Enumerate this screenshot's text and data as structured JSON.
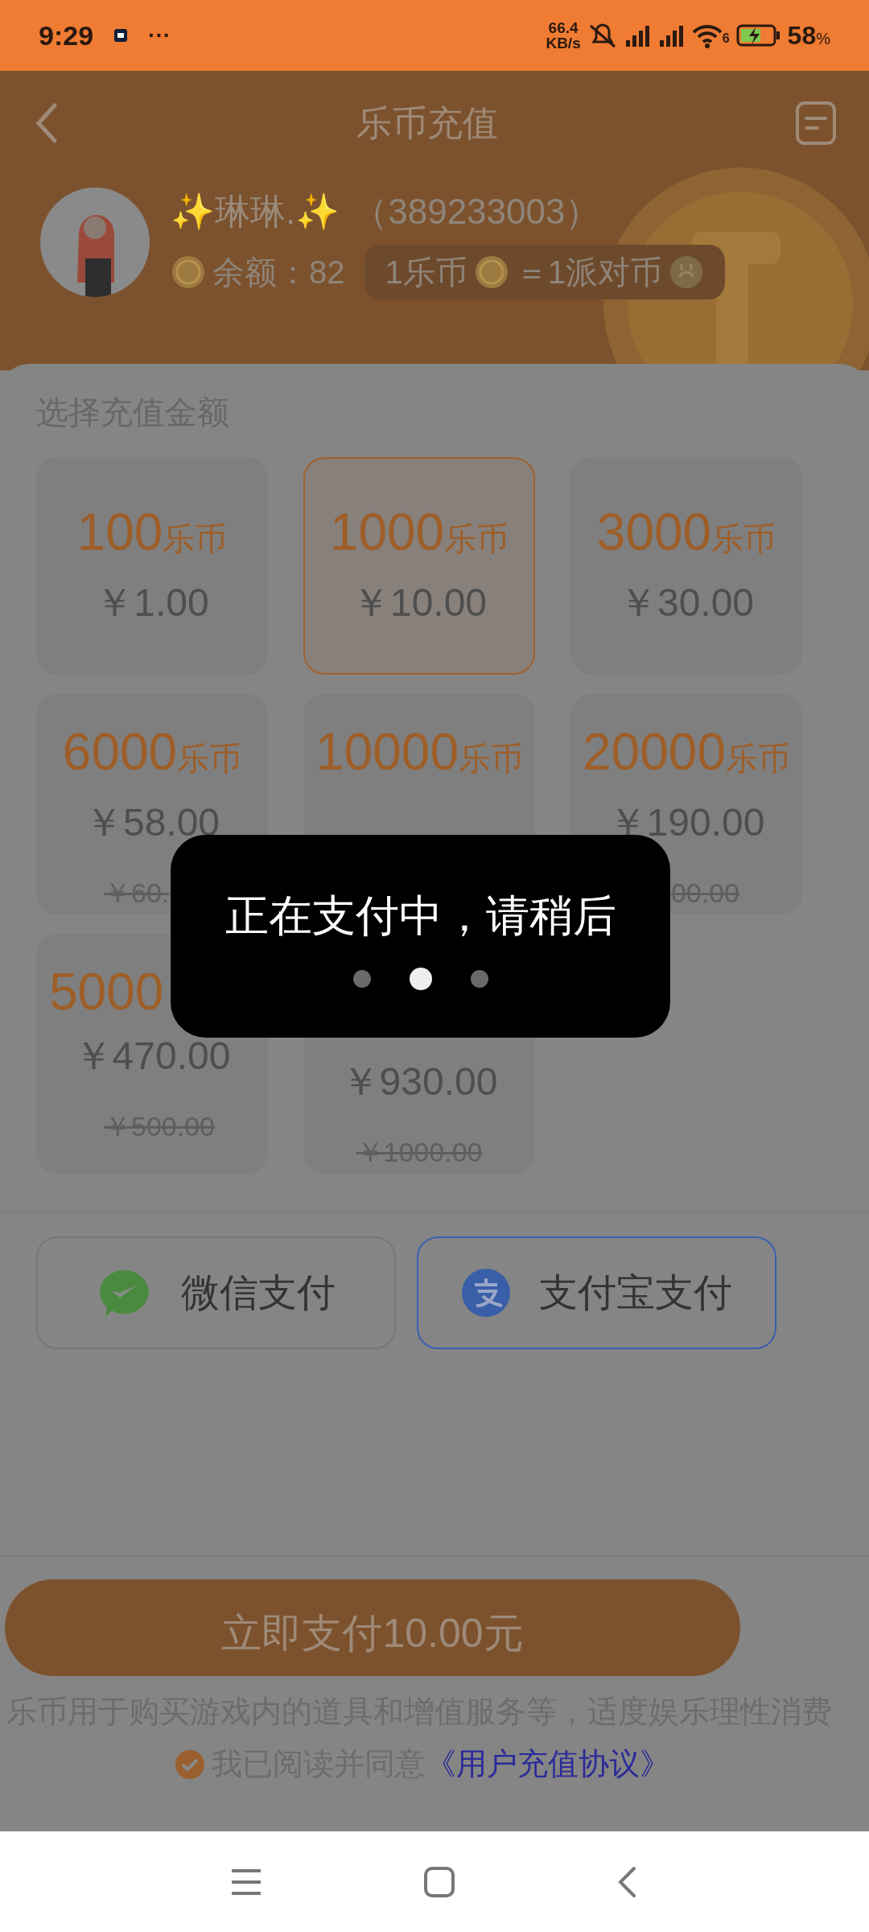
{
  "status_bar": {
    "time": "9:29",
    "more": "···",
    "speed_value": "66.4",
    "speed_unit": "KB/s",
    "wifi_badge": "6",
    "battery": "58",
    "battery_unit": "%"
  },
  "header": {
    "title": "乐币充值"
  },
  "profile": {
    "name": "✨琳琳.✨",
    "id": "（389233003）",
    "balance_label": "余额：82",
    "rate_left": "1乐币",
    "rate_right": "＝1派对币"
  },
  "section_title": "选择充值金额",
  "tiles": [
    {
      "amount": "100",
      "unit": "乐币",
      "price": "￥1.00",
      "selected": false
    },
    {
      "amount": "1000",
      "unit": "乐币",
      "price": "￥10.00",
      "selected": true
    },
    {
      "amount": "3000",
      "unit": "乐币",
      "price": "￥30.00",
      "selected": false
    },
    {
      "amount": "6000",
      "unit": "乐币",
      "price": "￥58.00",
      "original": "￥60.",
      "selected": false
    },
    {
      "amount": "10000",
      "unit": "乐币",
      "selected": false
    },
    {
      "amount": "20000",
      "unit": "乐币",
      "price": "￥190.00",
      "original": "00.00",
      "selected": false
    },
    {
      "amount": "5000",
      "price": "￥470.00",
      "original": "￥500.00",
      "selected": false
    },
    {
      "price": "￥930.00",
      "original": "￥1000.00",
      "selected": false
    }
  ],
  "payment_methods": [
    {
      "kind": "wechat",
      "label": "微信支付",
      "selected": false
    },
    {
      "kind": "alipay",
      "label": "支付宝支付",
      "selected": true
    }
  ],
  "pay_button": "立即支付10.00元",
  "disclaimer": "乐币用于购买游戏内的道具和增值服务等，适度娱乐理性消费",
  "agreement": {
    "checked": true,
    "text": "我已阅读并同意",
    "link": "《用户充值协议》"
  },
  "toast": {
    "message": "正在支付中，请稍后",
    "dots": [
      {
        "selected": false
      },
      {
        "selected": true
      },
      {
        "selected": false
      }
    ]
  }
}
